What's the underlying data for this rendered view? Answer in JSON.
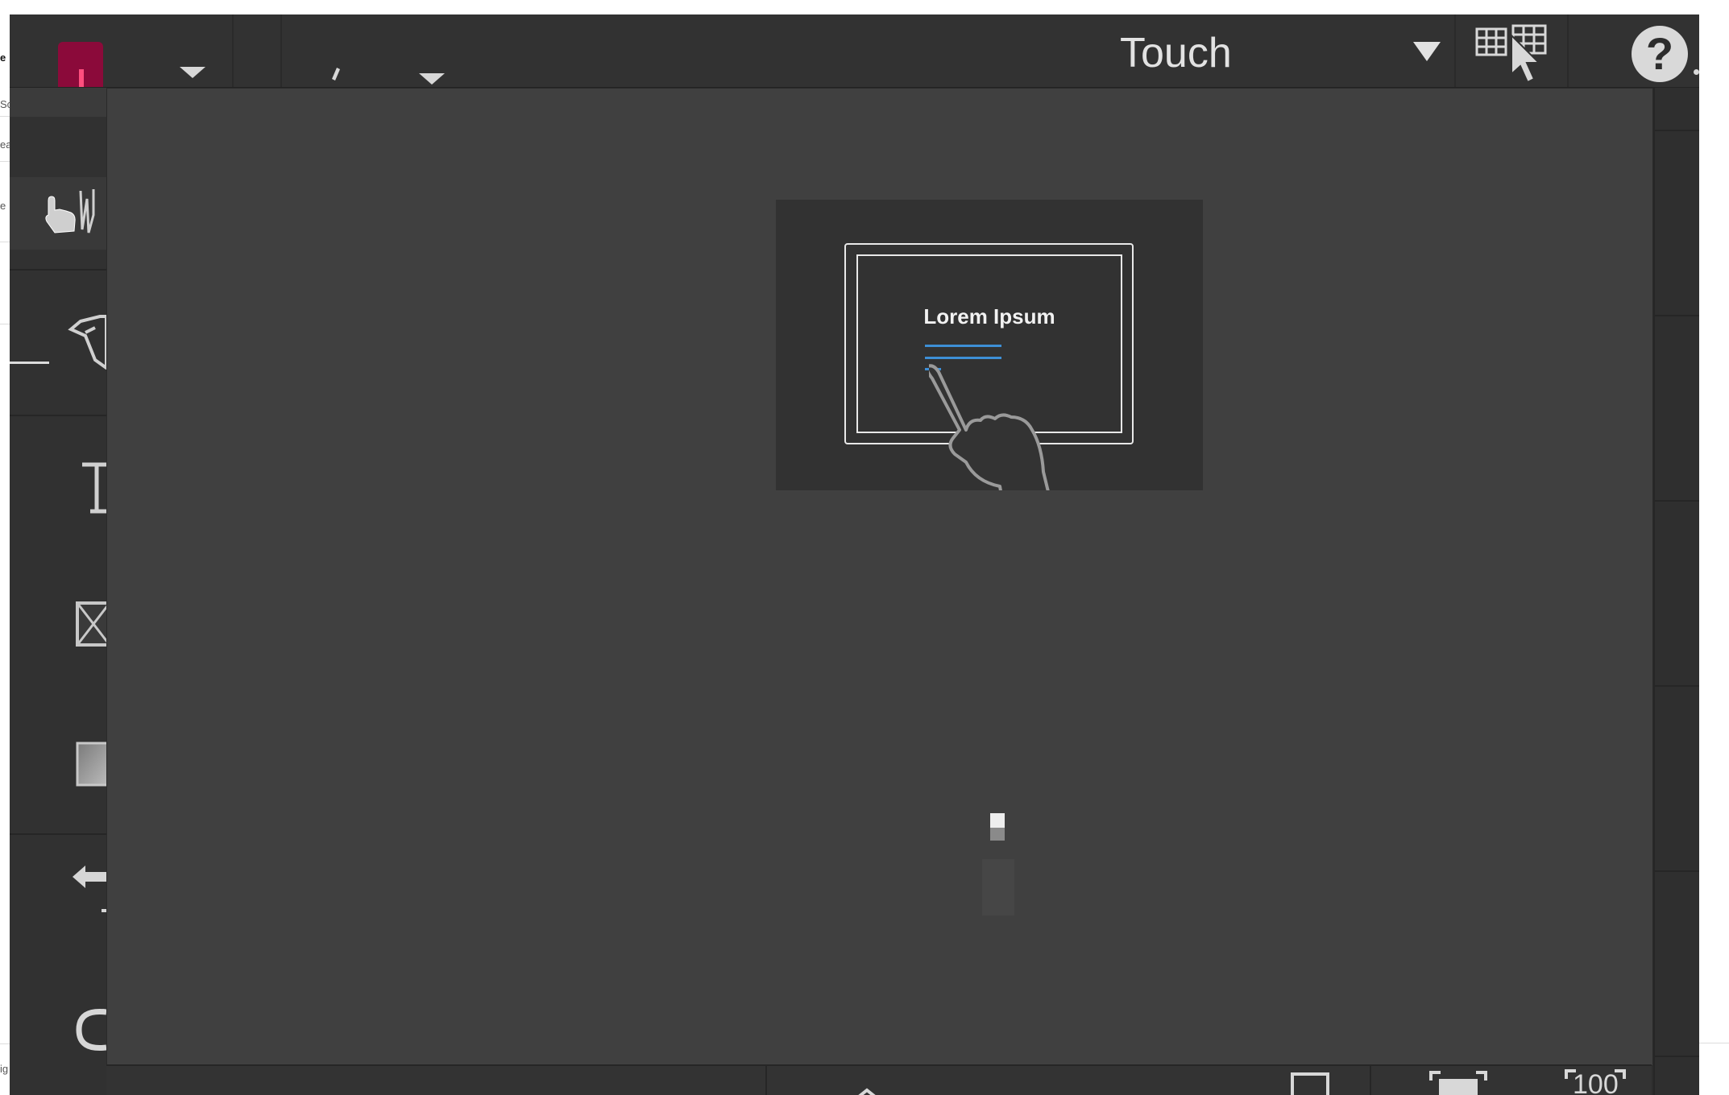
{
  "toolbar": {
    "mode_label": "Touch"
  },
  "onboarding": {
    "illustration_text": "Lorem Ipsum"
  },
  "bottombar": {
    "zoom_label": "100"
  },
  "background_app": {
    "fragments": [
      "e",
      "Sc",
      "ea",
      "e",
      "ig"
    ]
  },
  "icons": {
    "logo": "app-logo",
    "help": "help-icon",
    "keyboard_pointer": "grid-pointer-icon"
  },
  "colors": {
    "window_bg": "#2d2d2d",
    "modal_bg": "#404040",
    "accent_blue": "#3d8fd6",
    "logo_red": "#8b0a3a"
  }
}
